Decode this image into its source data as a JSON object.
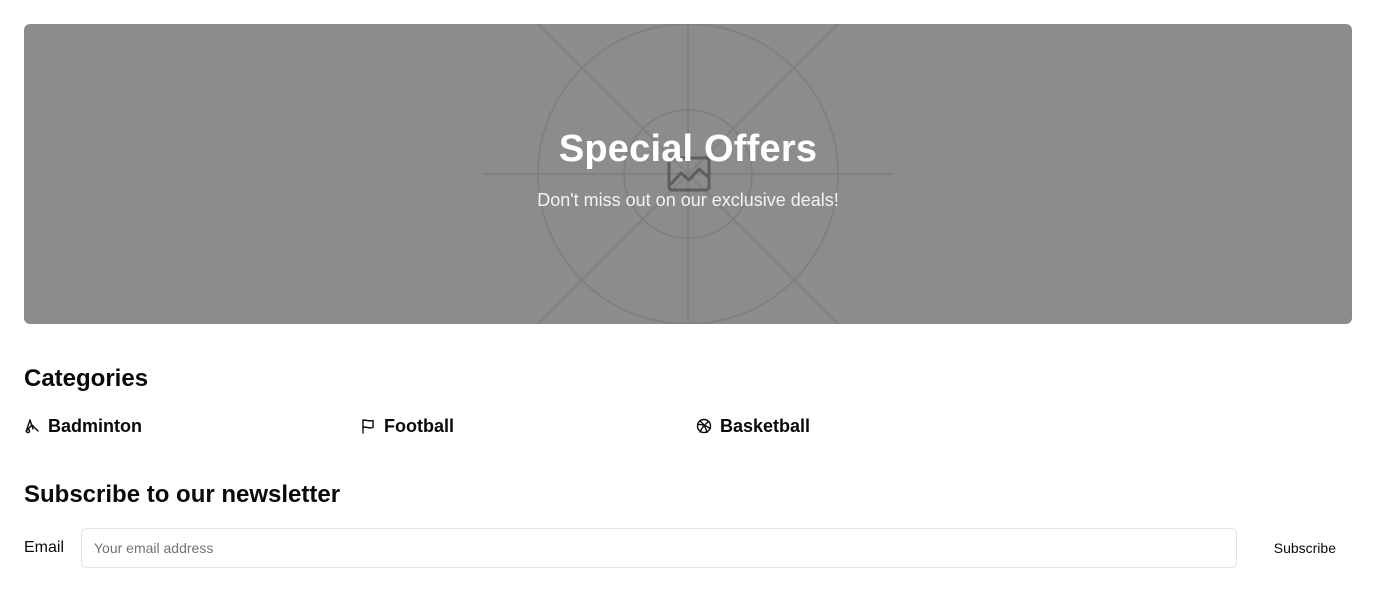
{
  "hero": {
    "title": "Special Offers",
    "subtitle": "Don't miss out on our exclusive deals!",
    "image_icon": "image-placeholder-icon",
    "background_color": "#8c8c8c"
  },
  "categories": {
    "title": "Categories",
    "items": [
      {
        "label": "Badminton",
        "icon": "badminton-shuttlecock-icon"
      },
      {
        "label": "Football",
        "icon": "flag-icon"
      },
      {
        "label": "Basketball",
        "icon": "basketball-icon"
      }
    ]
  },
  "newsletter": {
    "title": "Subscribe to our newsletter",
    "email_label": "Email",
    "email_value": "",
    "email_placeholder": "Your email address",
    "subscribe_label": "Subscribe"
  }
}
